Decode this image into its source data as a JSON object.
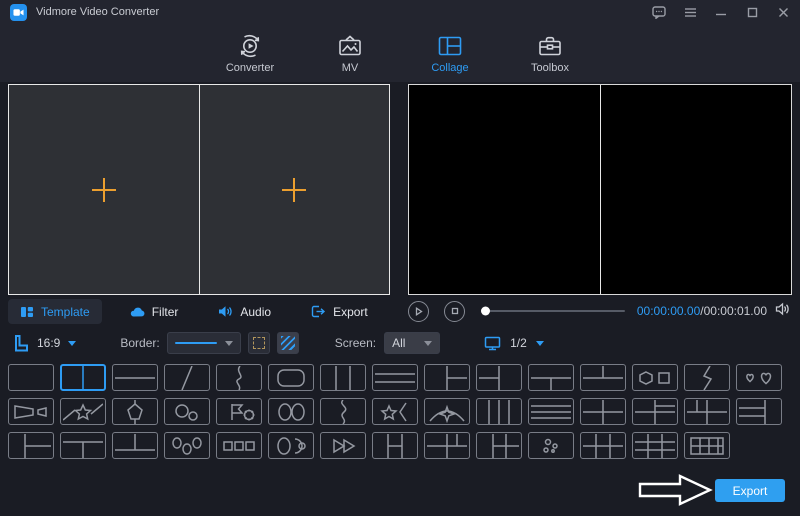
{
  "window": {
    "title": "Vidmore Video Converter",
    "controls": {
      "feedback": "feedback",
      "menu": "menu",
      "minimize": "minimize",
      "maximize": "maximize",
      "close": "close"
    }
  },
  "nav": {
    "tabs": [
      {
        "label": "Converter",
        "icon": "converter-icon",
        "active": false
      },
      {
        "label": "MV",
        "icon": "mv-icon",
        "active": false
      },
      {
        "label": "Collage",
        "icon": "collage-icon",
        "active": true
      },
      {
        "label": "Toolbox",
        "icon": "toolbox-icon",
        "active": false
      }
    ]
  },
  "left_tabs": [
    {
      "label": "Template",
      "icon": "template-icon",
      "active": true
    },
    {
      "label": "Filter",
      "icon": "filter-icon",
      "active": false
    },
    {
      "label": "Audio",
      "icon": "audio-icon",
      "active": false
    },
    {
      "label": "Export",
      "icon": "export-icon",
      "active": false
    }
  ],
  "player": {
    "current_time": "00:00:00.00",
    "separator": "/",
    "total_time": "00:00:01.00",
    "progress_percent": 0
  },
  "toolbar": {
    "aspect_ratio": "16:9",
    "border_label": "Border:",
    "screen_label": "Screen:",
    "screen_value": "All",
    "page_indicator": "1/2"
  },
  "export": {
    "label": "Export"
  },
  "colors": {
    "accent": "#2e9cf4",
    "plus_orange": "#ec9f2f",
    "export_button": "#2f9ff0",
    "background": "#1a1c24",
    "header_background": "#23252f"
  },
  "templates": {
    "selected": [
      0,
      1
    ],
    "rows": [
      [
        "single",
        "split-vertical",
        "split-horizontal",
        "diagonal-split",
        "curve-split",
        "rounded-inset",
        "three-columns",
        "three-rows",
        "left-cell-right-stack",
        "left-stack-right-cell",
        "top-cell-bottom-split",
        "top-split-bottom-cell",
        "hexagon-square",
        "zigzag-split",
        "two-hearts"
      ],
      [
        "megaphone-shapes",
        "star-band",
        "pentagon-band",
        "two-circles",
        "flag-gear",
        "two-ovals",
        "puzzle-split",
        "star-bracket",
        "arc-star",
        "four-columns",
        "four-rows",
        "grid-2x2",
        "grid-2x2-right-split",
        "grid-2x2-top-split",
        "left-rows-right-column"
      ],
      [
        "left-column-right-rows",
        "top-row-bottom-columns",
        "top-columns-bottom-row",
        "three-ovals",
        "three-squares",
        "oval-and-dots",
        "two-arrows",
        "three-columns-middle-split",
        "grid-mixed-a",
        "grid-mixed-b",
        "scatter-dots",
        "grid-3x2",
        "grid-3x3",
        "framed-grid"
      ]
    ]
  }
}
